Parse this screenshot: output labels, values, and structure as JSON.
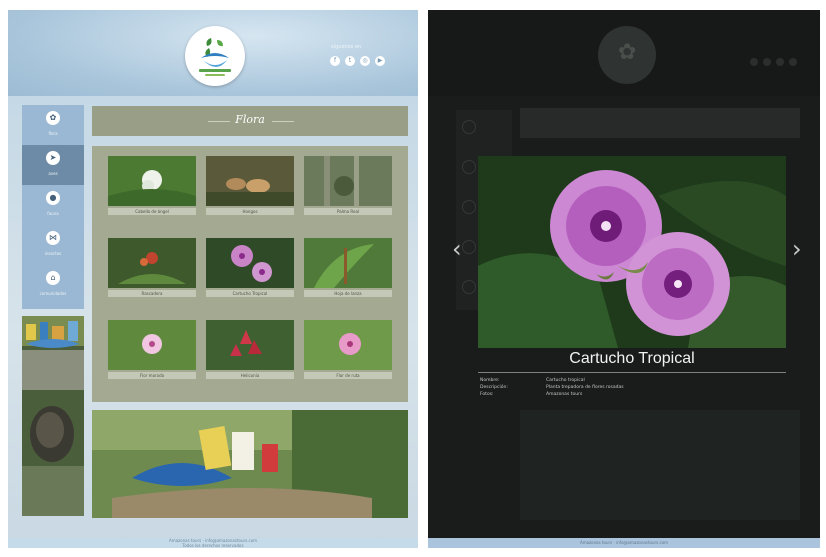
{
  "left_page": {
    "social_label": "síguenos en",
    "social_icons": [
      "f",
      "t",
      "◎",
      "▶"
    ],
    "sidebar_items": [
      {
        "label": "flora",
        "icon": "flower-icon"
      },
      {
        "label": "aves",
        "icon": "bird-icon"
      },
      {
        "label": "fauna",
        "icon": "frog-icon"
      },
      {
        "label": "insectos",
        "icon": "butterfly-icon"
      },
      {
        "label": "comunidades",
        "icon": "house-icon"
      }
    ],
    "section_title": "Flora",
    "thumbnails": [
      {
        "caption": "Cabello de ángel"
      },
      {
        "caption": "Hongos"
      },
      {
        "caption": "Palma Real"
      },
      {
        "caption": "Rascadera"
      },
      {
        "caption": "Cartucho Tropical"
      },
      {
        "caption": "Hoja de lanza"
      },
      {
        "caption": "Flor morada"
      },
      {
        "caption": "Heliconia"
      },
      {
        "caption": "Flor de ruta"
      }
    ],
    "footer_lines": [
      "Amazonas tours · info@amazonastours.com",
      "Todos los derechos reservados"
    ]
  },
  "right_page": {
    "caption_title": "Cartucho Tropical",
    "details": [
      {
        "label": "Nombre:",
        "value": "Cartucho tropical"
      },
      {
        "label": "Descripción:",
        "value": "Planta trepadora de flores rosadas"
      },
      {
        "label": "Fotos:",
        "value": "Amazonas tours"
      }
    ],
    "prev_label": "‹",
    "next_label": "›",
    "footer_line": "Amazonas tours · info@amazonastours.com"
  }
}
